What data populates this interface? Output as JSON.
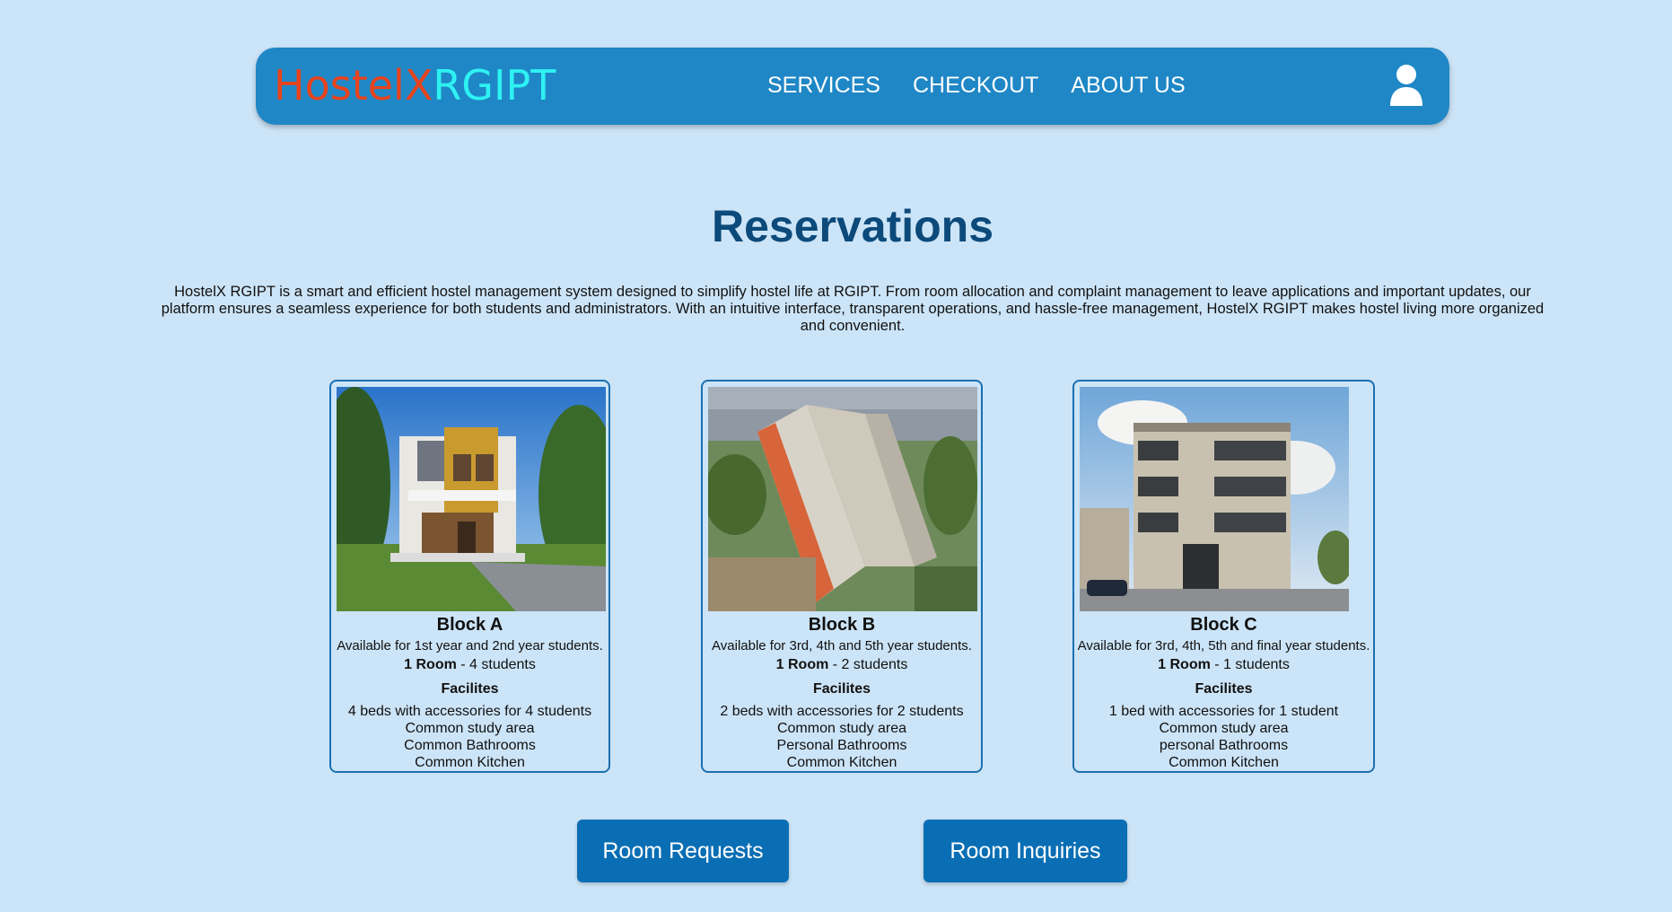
{
  "app": {
    "logo_part1": "HostelX",
    "logo_part2": "RGIPT"
  },
  "nav": {
    "items": [
      "SERVICES",
      "CHECKOUT",
      "ABOUT US"
    ],
    "user_icon": "user-icon"
  },
  "page": {
    "title": "Reservations",
    "description": "HostelX RGIPT is a smart and efficient hostel management system designed to simplify hostel life at RGIPT. From room allocation and complaint management to leave applications and important updates, our platform ensures a seamless experience for both students and administrators. With an intuitive interface, transparent operations, and hassle-free management, HostelX RGIPT makes hostel living more organized and convenient."
  },
  "blocks": [
    {
      "name": "Block A",
      "availability": "Available for 1st year and 2nd year students.",
      "room_label": "1 Room",
      "room_value": " - 4 students",
      "facilities_title": "Facilites",
      "facilities": [
        "4 beds with accessories for 4 students",
        "Common study area",
        "Common Bathrooms",
        "Common Kitchen"
      ]
    },
    {
      "name": "Block B",
      "availability": "Available for 3rd, 4th and 5th year students.",
      "room_label": "1 Room",
      "room_value": " - 2 students",
      "facilities_title": "Facilites",
      "facilities": [
        "2 beds with accessories for 2 students",
        "Common study area",
        "Personal Bathrooms",
        "Common Kitchen"
      ]
    },
    {
      "name": "Block C",
      "availability": "Available for 3rd, 4th, 5th and final year students.",
      "room_label": "1 Room",
      "room_value": " - 1 students",
      "facilities_title": "Facilites",
      "facilities": [
        "1 bed with accessories for 1 student",
        "Common study area",
        "personal Bathrooms",
        "Common Kitchen"
      ]
    }
  ],
  "actions": {
    "room_requests": "Room Requests",
    "room_inquiries": "Room Inquiries"
  },
  "colors": {
    "background": "#cce4f7",
    "navbar": "#1f87c6",
    "logo_part1": "#e8431c",
    "logo_part2": "#2ef2f2",
    "title": "#0b4a7a",
    "button": "#0a6eb4",
    "card_border": "#1a6fb0"
  }
}
